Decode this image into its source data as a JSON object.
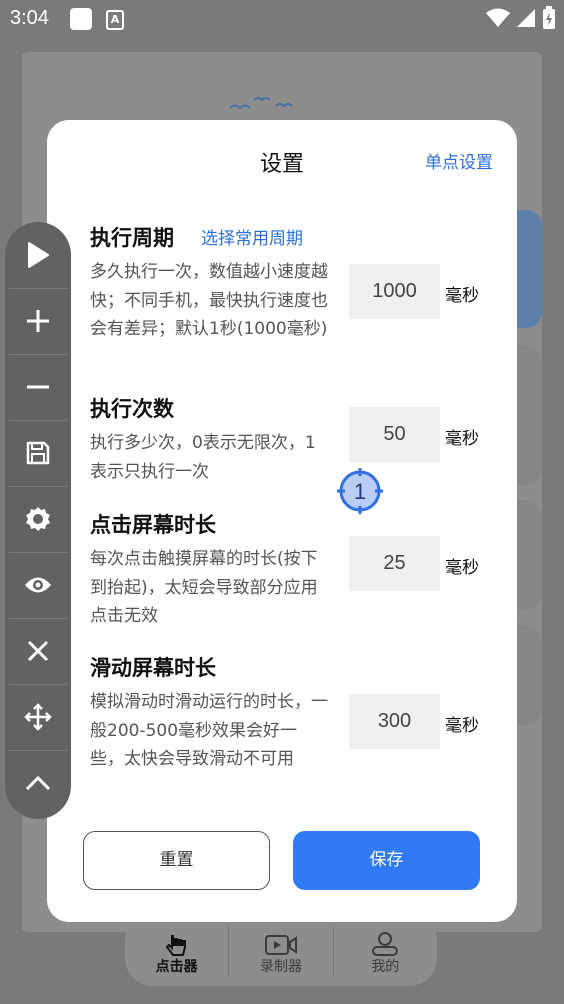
{
  "status_bar": {
    "time": "3:04",
    "a_icon": "A"
  },
  "dialog": {
    "title": "设置",
    "single_setting_link": "单点设置",
    "sections": [
      {
        "title": "执行周期",
        "link": "选择常用周期",
        "description": "多久执行一次，数值越小速度越快；不同手机，最快执行速度也会有差异；默认1秒(1000毫秒)",
        "value": "1000",
        "unit": "毫秒"
      },
      {
        "title": "执行次数",
        "description": "执行多少次，0表示无限次，1表示只执行一次",
        "value": "50",
        "unit": "毫秒"
      },
      {
        "title": "点击屏幕时长",
        "description": "每次点击触摸屏幕的时长(按下到抬起)，太短会导致部分应用点击无效",
        "value": "25",
        "unit": "毫秒"
      },
      {
        "title": "滑动屏幕时长",
        "description": "模拟滑动时滑动运行的时长，一般200-500毫秒效果会好一些，太快会导致滑动不可用",
        "value": "300",
        "unit": "毫秒"
      }
    ],
    "reset_label": "重置",
    "save_label": "保存"
  },
  "toolbar": {
    "items": [
      "play-icon",
      "plus-icon",
      "minus-icon",
      "save-icon",
      "settings-icon",
      "eye-icon",
      "close-icon",
      "move-icon",
      "chevron-up-icon"
    ]
  },
  "target_marker": {
    "number": "1"
  },
  "bottom_nav": {
    "items": [
      {
        "label": "点击器",
        "icon": "hand-tap-icon",
        "active": true
      },
      {
        "label": "录制器",
        "icon": "video-icon",
        "active": false
      },
      {
        "label": "我的",
        "icon": "person-icon",
        "active": false
      }
    ]
  },
  "colors": {
    "accent": "#2f7bf5",
    "link": "#2e6fe0",
    "overlay": "#7a7a7a"
  }
}
